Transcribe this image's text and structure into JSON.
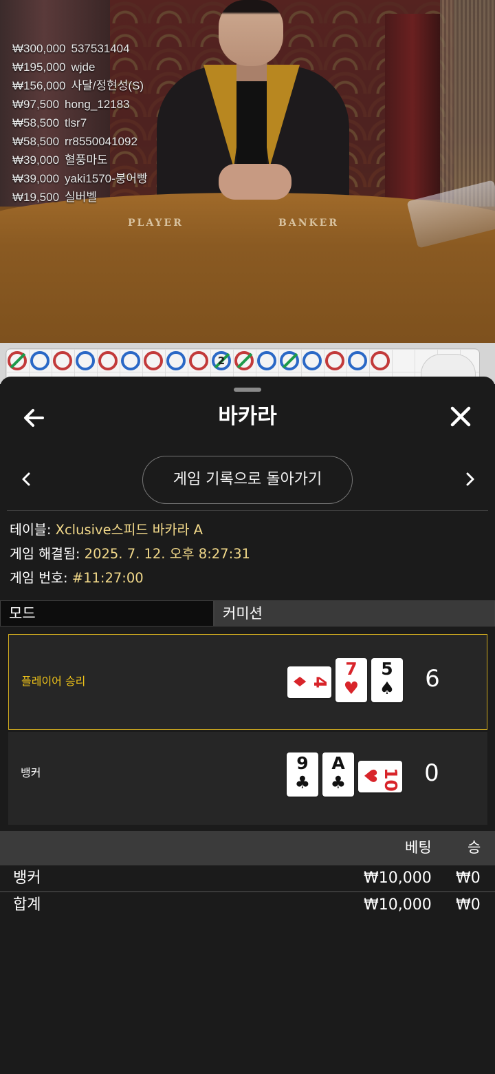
{
  "stream": {
    "leaderboard": [
      {
        "amount": "₩300,000",
        "name": "537531404"
      },
      {
        "amount": "₩195,000",
        "name": "wjde"
      },
      {
        "amount": "₩156,000",
        "name": "사달/정현성(S)"
      },
      {
        "amount": "₩97,500",
        "name": "hong_12183"
      },
      {
        "amount": "₩58,500",
        "name": "tlsr7"
      },
      {
        "amount": "₩58,500",
        "name": "rr8550041092"
      },
      {
        "amount": "₩39,000",
        "name": "혈풍마도"
      },
      {
        "amount": "₩39,000",
        "name": "yaki1570-붕어빵"
      },
      {
        "amount": "₩19,500",
        "name": "실버벨"
      }
    ],
    "table_player_label": "PLAYER",
    "table_banker_label": "BANKER"
  },
  "road": {
    "marks": [
      "tie-banker",
      "player",
      "banker",
      "player",
      "banker",
      "player",
      "banker",
      "player",
      "banker",
      "tie-player",
      "tie-banker",
      "player",
      "tie-player",
      "player",
      "banker",
      "player",
      "banker"
    ],
    "tie_count": "2"
  },
  "sheet": {
    "title": "바카라",
    "back_to_history": "게임 기록으로 돌아가기",
    "table_label": "테이블:",
    "table_value": "Xclusive스피드 바카라 A",
    "resolved_label": "게임 해결됨:",
    "resolved_value": "2025. 7. 12. 오후 8:27:31",
    "game_no_label": "게임 번호:",
    "game_no_value": "#11:27:00",
    "tab_mode": "모드",
    "tab_commission": "커미션",
    "player": {
      "label": "플레이어 승리",
      "score": "6",
      "cards": [
        {
          "rank": "4",
          "suit": "♦",
          "color": "#d8242a",
          "orientation": "horizontal"
        },
        {
          "rank": "7",
          "suit": "♥",
          "color": "#d8242a",
          "orientation": "vertical"
        },
        {
          "rank": "5",
          "suit": "♠",
          "color": "#111111",
          "orientation": "vertical"
        }
      ]
    },
    "banker": {
      "label": "뱅커",
      "score": "0",
      "cards": [
        {
          "rank": "9",
          "suit": "♣",
          "color": "#111111",
          "orientation": "vertical"
        },
        {
          "rank": "A",
          "suit": "♣",
          "color": "#111111",
          "orientation": "vertical"
        },
        {
          "rank": "10",
          "suit": "♥",
          "color": "#d8242a",
          "orientation": "horizontal"
        }
      ]
    },
    "bets": {
      "col_bet": "베팅",
      "col_win": "승",
      "rows": [
        {
          "name": "뱅커",
          "bet": "₩10,000",
          "win": "₩0"
        },
        {
          "name": "합계",
          "bet": "₩10,000",
          "win": "₩0"
        }
      ]
    },
    "win_color": "#f0c419",
    "value_color": "#f2d98a"
  }
}
